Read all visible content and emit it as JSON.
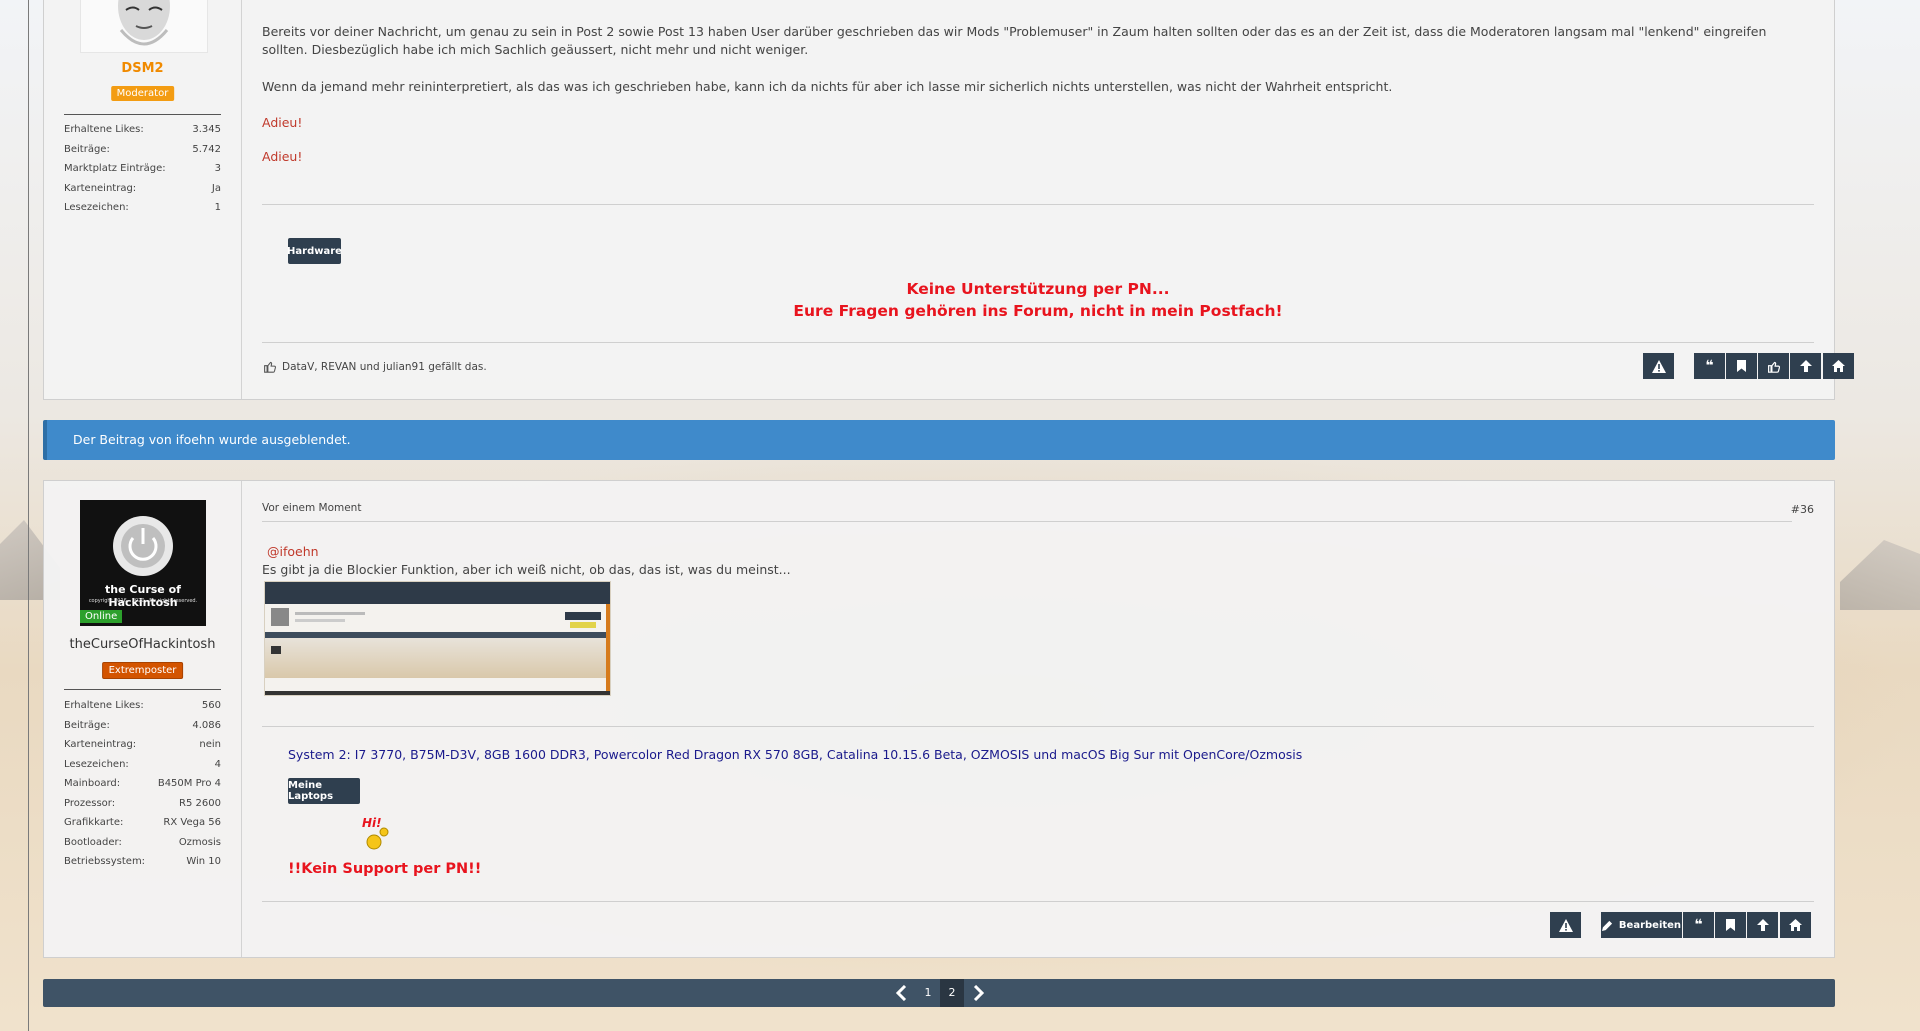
{
  "post1": {
    "user": {
      "name": "DSM2",
      "rank": "Moderator",
      "name_color": "#f08a00",
      "rank_color": "#f39c12"
    },
    "stats": [
      {
        "label": "Erhaltene Likes:",
        "value": "3.345"
      },
      {
        "label": "Beiträge:",
        "value": "5.742"
      },
      {
        "label": "Marktplatz Einträge:",
        "value": "3"
      },
      {
        "label": "Karteneintrag:",
        "value": "Ja"
      },
      {
        "label": "Lesezeichen:",
        "value": "1"
      }
    ],
    "paragraphs": [
      "Bereits vor deiner Nachricht, um genau zu sein in Post 2 sowie Post 13 haben User darüber geschrieben das wir Mods \"Problemuser\" in Zaum halten sollten oder das es an der Zeit ist, dass die Moderatoren langsam mal \"lenkend\" eingreifen sollten. Diesbezüglich habe ich mich Sachlich geäussert, nicht mehr und nicht weniger.",
      "Wenn da jemand mehr reininterpretiert, als das was ich geschrieben habe, kann ich da nichts für aber ich lasse mir sicherlich nichts unterstellen, was nicht der Wahrheit entspricht."
    ],
    "closing1": "Adieu!",
    "closing2": "Adieu!",
    "sig_button": "Hardware",
    "sig_line1": "Keine Unterstützung per PN...",
    "sig_line2": "Eure Fragen gehören ins Forum, nicht in mein Postfach!",
    "likes_text": "DataV, REVAN und julian91 gefällt das."
  },
  "hidden_notice": "Der Beitrag von ifoehn wurde ausgeblendet.",
  "post2": {
    "user": {
      "name": "theCurseOfHackintosh",
      "rank": "Extremposter",
      "rank_color": "#d35400",
      "online": "Online"
    },
    "avatar_text": "the Curse of Hackintosh",
    "avatar_copyright": "copyright 2016 - 2020 . No rights reserved.",
    "stats": [
      {
        "label": "Erhaltene Likes:",
        "value": "560"
      },
      {
        "label": "Beiträge:",
        "value": "4.086"
      },
      {
        "label": "Karteneintrag:",
        "value": "nein"
      },
      {
        "label": "Lesezeichen:",
        "value": "4"
      },
      {
        "label": "Mainboard:",
        "value": "B450M Pro 4"
      },
      {
        "label": "Prozessor:",
        "value": "R5 2600"
      },
      {
        "label": "Grafikkarte:",
        "value": "RX Vega 56"
      },
      {
        "label": "Bootloader:",
        "value": "Ozmosis"
      },
      {
        "label": "Betriebssystem:",
        "value": "Win 10"
      }
    ],
    "time": "Vor einem Moment",
    "number": "#36",
    "mention": "@ifoehn",
    "text": "Es gibt ja die Blockier Funktion, aber ich weiß nicht, ob das, das ist, was du meinst...",
    "system_line": "System 2: I7 3770, B75M-D3V, 8GB 1600 DDR3, Powercolor Red Dragon RX 570 8GB, Catalina 10.15.6 Beta, OZMOSIS und macOS Big Sur mit OpenCore/Ozmosis",
    "sig_button": "Meine Laptops",
    "hi_text": "Hi!",
    "no_support": "!!Kein Support per PN!!",
    "edit_label": "Bearbeiten"
  },
  "pagination": {
    "pages": [
      "1",
      "2"
    ],
    "current": "2"
  }
}
